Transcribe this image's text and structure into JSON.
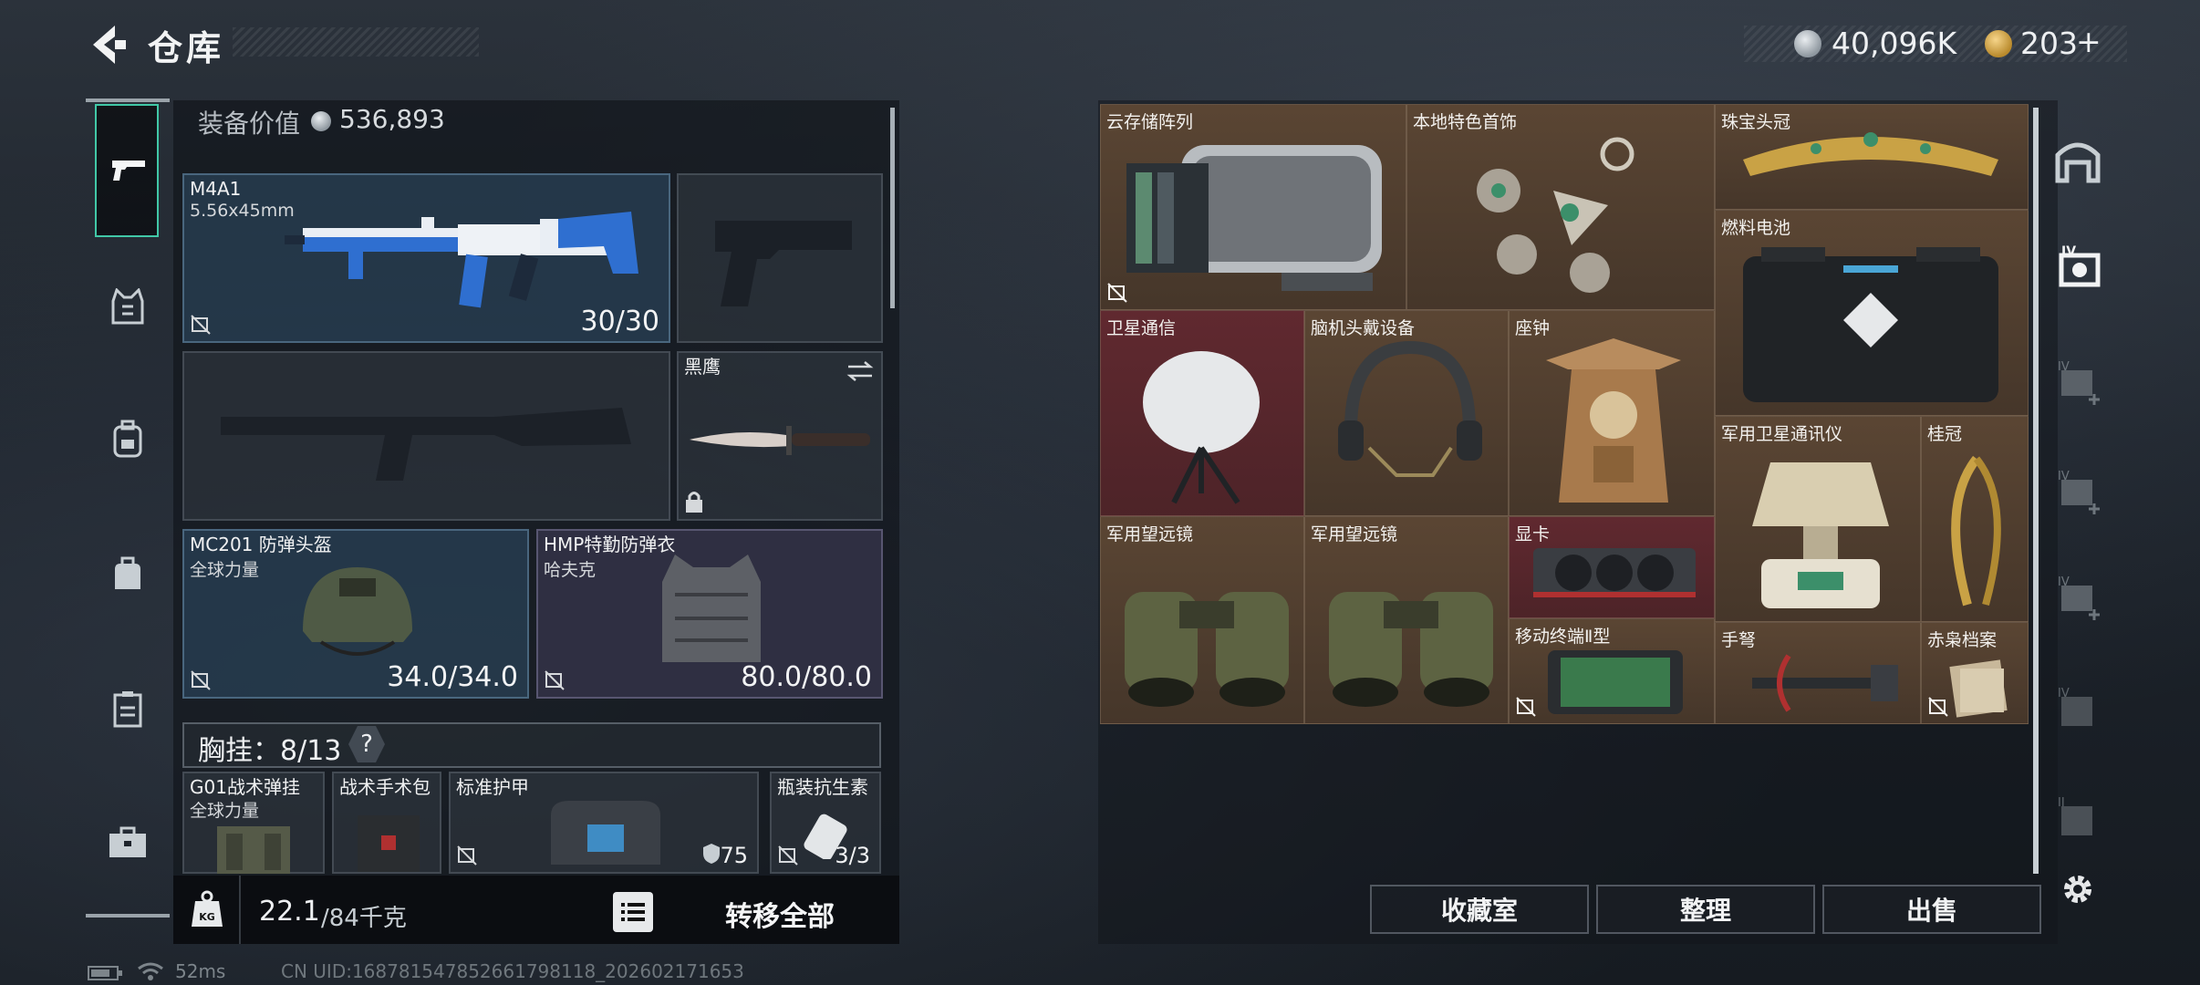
{
  "header": {
    "title": "仓库",
    "currency": [
      {
        "icon": "silver-coin-icon",
        "value": "40,096K"
      },
      {
        "icon": "gold-coin-icon",
        "value": "203"
      }
    ],
    "add_symbol": "+"
  },
  "rail": {
    "items": [
      "pistol-icon",
      "vest-icon",
      "backpack-icon",
      "bag-icon",
      "locker-icon",
      "toolbox-icon"
    ]
  },
  "equipment": {
    "value_label": "装备价值",
    "value": "536,893",
    "primary": {
      "name": "M4A1",
      "caliber": "5.56x45mm",
      "ammo": "30/30"
    },
    "melee": {
      "name": "黑鹰"
    },
    "helmet": {
      "name": "MC201 防弹头盔",
      "brand": "全球力量",
      "durability": "34.0/34.0"
    },
    "armor": {
      "name": "HMP特勤防弹衣",
      "brand": "哈夫克",
      "durability": "80.0/80.0"
    },
    "rig": {
      "label": "胸挂：8/13",
      "help": "?"
    },
    "rig_items": [
      {
        "name": "G01战术弹挂",
        "sub": "全球力量"
      },
      {
        "name": "战术手术包"
      },
      {
        "name": "标准护甲",
        "value": "75"
      },
      {
        "name": "瓶装抗生素",
        "count": "3/3"
      }
    ],
    "weight": "22.1",
    "weight_max": "/84千克",
    "transfer_all": "转移全部"
  },
  "stash": {
    "items": [
      {
        "name": "云存储阵列",
        "rarity": "gold"
      },
      {
        "name": "本地特色首饰",
        "rarity": "gold"
      },
      {
        "name": "珠宝头冠",
        "rarity": "gold"
      },
      {
        "name": "燃料电池",
        "rarity": "gold"
      },
      {
        "name": "卫星通信",
        "rarity": "red"
      },
      {
        "name": "脑机头戴设备",
        "rarity": "gold"
      },
      {
        "name": "座钟",
        "rarity": "gold"
      },
      {
        "name": "军用卫星通讯仪",
        "rarity": "gold"
      },
      {
        "name": "桂冠",
        "rarity": "gold"
      },
      {
        "name": "军用望远镜",
        "rarity": "gold"
      },
      {
        "name": "军用望远镜",
        "rarity": "gold"
      },
      {
        "name": "显卡",
        "rarity": "red"
      },
      {
        "name": "移动终端Ⅱ型",
        "rarity": "gold"
      },
      {
        "name": "手弩",
        "rarity": "gold"
      },
      {
        "name": "赤枭档案",
        "rarity": "gold"
      }
    ],
    "buttons": {
      "collection": "收藏室",
      "sort": "整理",
      "sell": "出售"
    }
  },
  "status_bar": {
    "ping": "52ms",
    "uid": "CN UID:1687815478526617981​18_202602171653"
  },
  "colors": {
    "accent": "#41c8a7",
    "gold_cell": "#5c4634",
    "red_cell": "#622830"
  }
}
